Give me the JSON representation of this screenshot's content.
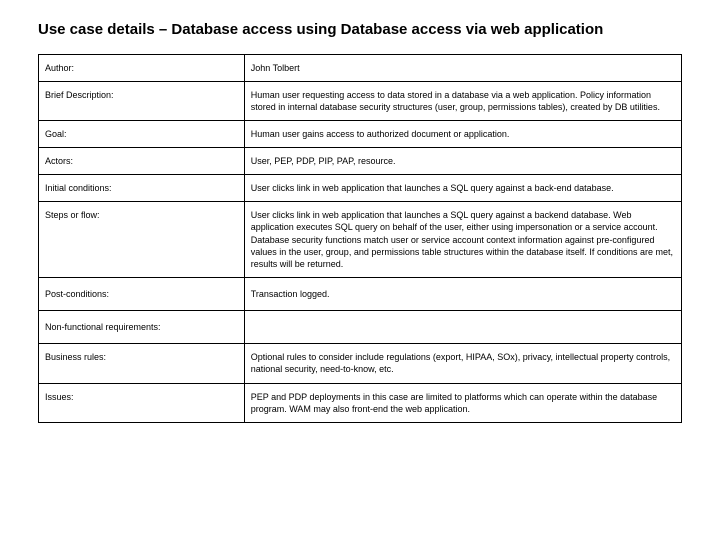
{
  "title": "Use case details – Database access using Database access via web application",
  "rows": [
    {
      "label": "Author:",
      "value": "John Tolbert"
    },
    {
      "label": "Brief Description:",
      "value": "Human user requesting access to data stored in a database via a web application.  Policy information stored in internal database security structures (user, group, permissions tables), created by DB utilities."
    },
    {
      "label": "Goal:",
      "value": "Human user gains access to authorized document or application."
    },
    {
      "label": "Actors:",
      "value": "User, PEP, PDP, PIP, PAP, resource."
    },
    {
      "label": "Initial conditions:",
      "value": "User clicks link in web application that launches a SQL query against a back-end database."
    },
    {
      "label": "Steps or flow:",
      "value": "User clicks link in web application that launches a SQL query against a backend database. Web application executes SQL query on behalf of the user, either using impersonation or a service account.  Database security functions match user or service account context information against pre-configured values in the user, group, and permissions table structures within the database itself.  If conditions are met, results will be returned."
    },
    {
      "label": "Post-conditions:",
      "value": "Transaction logged."
    },
    {
      "label": "Non-functional requirements:",
      "value": ""
    },
    {
      "label": "Business rules:",
      "value": "Optional rules to consider include regulations (export, HIPAA, SOx), privacy, intellectual property controls, national security, need-to-know, etc."
    },
    {
      "label": "Issues:",
      "value": "PEP and PDP deployments in this case are limited to platforms which can operate within the database program.  WAM may also front-end the web application."
    }
  ]
}
